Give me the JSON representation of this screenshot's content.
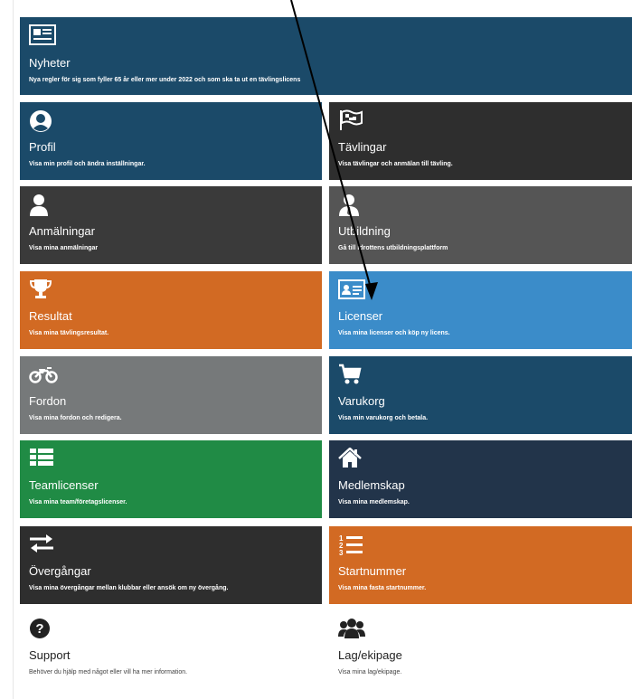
{
  "tiles": {
    "nyheter": {
      "title": "Nyheter",
      "desc": "Nya regler för sig som fyller 65 år eller mer under 2022 och som ska ta ut en tävlingslicens",
      "icon": "newspaper-icon",
      "color": "#1b4a69"
    },
    "profil": {
      "title": "Profil",
      "desc": "Visa min profil och ändra inställningar.",
      "icon": "user-circle-icon",
      "color": "#1b4a69"
    },
    "tavlingar": {
      "title": "Tävlingar",
      "desc": "Visa tävlingar och anmälan till tävling.",
      "icon": "checkered-flag-icon",
      "color": "#2e2e2e"
    },
    "anmalningar": {
      "title": "Anmälningar",
      "desc": "Visa mina anmälningar",
      "icon": "user-icon",
      "color": "#3a3a3a"
    },
    "utbildning": {
      "title": "Utbildning",
      "desc": "Gå till idrottens utbildningsplattform",
      "icon": "user-tie-icon",
      "color": "#555555"
    },
    "resultat": {
      "title": "Resultat",
      "desc": "Visa mina tävlingsresultat.",
      "icon": "trophy-icon",
      "color": "#d26a23"
    },
    "licenser": {
      "title": "Licenser",
      "desc": "Visa mina licenser och köp ny licens.",
      "icon": "id-card-icon",
      "color": "#3b8cc9"
    },
    "fordon": {
      "title": "Fordon",
      "desc": "Visa mina fordon och redigera.",
      "icon": "motorcycle-icon",
      "color": "#76797a"
    },
    "varukorg": {
      "title": "Varukorg",
      "desc": "Visa min varukorg och betala.",
      "icon": "cart-icon",
      "color": "#1b4a69"
    },
    "teamlicenser": {
      "title": "Teamlicenser",
      "desc": "Visa mina team/företagslicenser.",
      "icon": "list-icon",
      "color": "#208b45"
    },
    "medlemskap": {
      "title": "Medlemskap",
      "desc": "Visa mina medlemskap.",
      "icon": "home-icon",
      "color": "#22344a"
    },
    "overgangar": {
      "title": "Övergångar",
      "desc": "Visa mina övergångar mellan klubbar eller ansök om ny övergång.",
      "icon": "exchange-icon",
      "color": "#2e2e2e"
    },
    "startnummer": {
      "title": "Startnummer",
      "desc": "Visa mina fasta startnummer.",
      "icon": "numbered-list-icon",
      "color": "#d26a23"
    },
    "support": {
      "title": "Support",
      "desc": "Behöver du hjälp med något eller vill ha mer information.",
      "icon": "question-circle-icon",
      "color": "#ffffff"
    },
    "lag": {
      "title": "Lag/ekipage",
      "desc": "Visa mina lag/ekipage.",
      "icon": "users-icon",
      "color": "#ffffff"
    }
  }
}
